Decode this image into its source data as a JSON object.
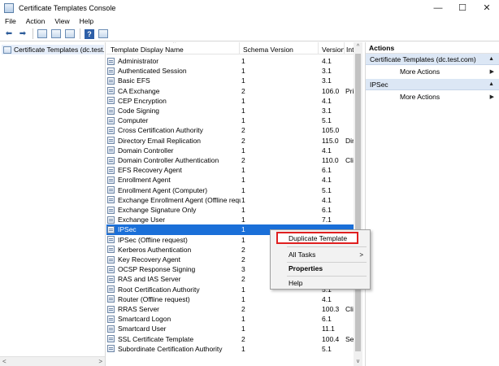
{
  "window": {
    "title": "Certificate Templates Console",
    "minimize_glyph": "—",
    "maximize_glyph": "☐",
    "close_glyph": "✕"
  },
  "menu": [
    "File",
    "Action",
    "View",
    "Help"
  ],
  "toolbar": {
    "icons": [
      "back-arrow-icon",
      "forward-arrow-icon",
      "console-tree-icon",
      "properties-icon",
      "export-list-icon",
      "help-icon",
      "show-action-pane-icon"
    ],
    "back_glyph": "⬅",
    "forward_glyph": "➡",
    "help_glyph": "?"
  },
  "tree": {
    "root_label": "Certificate Templates (dc.test.co",
    "scroll_left": "<",
    "scroll_right": ">"
  },
  "columns": {
    "name": "Template Display Name",
    "schema": "Schema Version",
    "version": "Version",
    "int": "Int"
  },
  "rows": [
    {
      "name": "Administrator",
      "schema": "1",
      "version": "4.1",
      "int": ""
    },
    {
      "name": "Authenticated Session",
      "schema": "1",
      "version": "3.1",
      "int": ""
    },
    {
      "name": "Basic EFS",
      "schema": "1",
      "version": "3.1",
      "int": ""
    },
    {
      "name": "CA Exchange",
      "schema": "2",
      "version": "106.0",
      "int": "Pri"
    },
    {
      "name": "CEP Encryption",
      "schema": "1",
      "version": "4.1",
      "int": ""
    },
    {
      "name": "Code Signing",
      "schema": "1",
      "version": "3.1",
      "int": ""
    },
    {
      "name": "Computer",
      "schema": "1",
      "version": "5.1",
      "int": ""
    },
    {
      "name": "Cross Certification Authority",
      "schema": "2",
      "version": "105.0",
      "int": ""
    },
    {
      "name": "Directory Email Replication",
      "schema": "2",
      "version": "115.0",
      "int": "Dir"
    },
    {
      "name": "Domain Controller",
      "schema": "1",
      "version": "4.1",
      "int": ""
    },
    {
      "name": "Domain Controller Authentication",
      "schema": "2",
      "version": "110.0",
      "int": "Cli"
    },
    {
      "name": "EFS Recovery Agent",
      "schema": "1",
      "version": "6.1",
      "int": ""
    },
    {
      "name": "Enrollment Agent",
      "schema": "1",
      "version": "4.1",
      "int": ""
    },
    {
      "name": "Enrollment Agent (Computer)",
      "schema": "1",
      "version": "5.1",
      "int": ""
    },
    {
      "name": "Exchange Enrollment Agent (Offline requ...",
      "schema": "1",
      "version": "4.1",
      "int": ""
    },
    {
      "name": "Exchange Signature Only",
      "schema": "1",
      "version": "6.1",
      "int": ""
    },
    {
      "name": "Exchange User",
      "schema": "1",
      "version": "7.1",
      "int": ""
    },
    {
      "name": "IPSec",
      "schema": "1",
      "version": "",
      "int": ""
    },
    {
      "name": "IPSec (Offline request)",
      "schema": "1",
      "version": "",
      "int": ""
    },
    {
      "name": "Kerberos Authentication",
      "schema": "2",
      "version": "",
      "int": ""
    },
    {
      "name": "Key Recovery Agent",
      "schema": "2",
      "version": "",
      "int": ""
    },
    {
      "name": "OCSP Response Signing",
      "schema": "3",
      "version": "",
      "int": ""
    },
    {
      "name": "RAS and IAS Server",
      "schema": "2",
      "version": "",
      "int": ""
    },
    {
      "name": "Root Certification Authority",
      "schema": "1",
      "version": "5.1",
      "int": ""
    },
    {
      "name": "Router (Offline request)",
      "schema": "1",
      "version": "4.1",
      "int": ""
    },
    {
      "name": "RRAS Server",
      "schema": "2",
      "version": "100.3",
      "int": "Cli"
    },
    {
      "name": "Smartcard Logon",
      "schema": "1",
      "version": "6.1",
      "int": ""
    },
    {
      "name": "Smartcard User",
      "schema": "1",
      "version": "11.1",
      "int": ""
    },
    {
      "name": "SSL Certificate Template",
      "schema": "2",
      "version": "100.4",
      "int": "Se"
    },
    {
      "name": "Subordinate Certification Authority",
      "schema": "1",
      "version": "5.1",
      "int": ""
    }
  ],
  "selected_row": "IPSec",
  "list_scroll": {
    "up": "^",
    "down": "v"
  },
  "actions": {
    "title": "Actions",
    "section1": "Certificate Templates (dc.test.com)",
    "section2": "IPSec",
    "more_actions": "More Actions",
    "collapse_glyph": "▲",
    "submenu_glyph": "▶"
  },
  "context_menu": {
    "duplicate": "Duplicate Template",
    "all_tasks": "All Tasks",
    "properties": "Properties",
    "help": "Help",
    "submenu_glyph": ">"
  },
  "colors": {
    "selection": "#1a6fd8",
    "highlight_border": "#e02020",
    "actions_section": "#dce7f5"
  }
}
